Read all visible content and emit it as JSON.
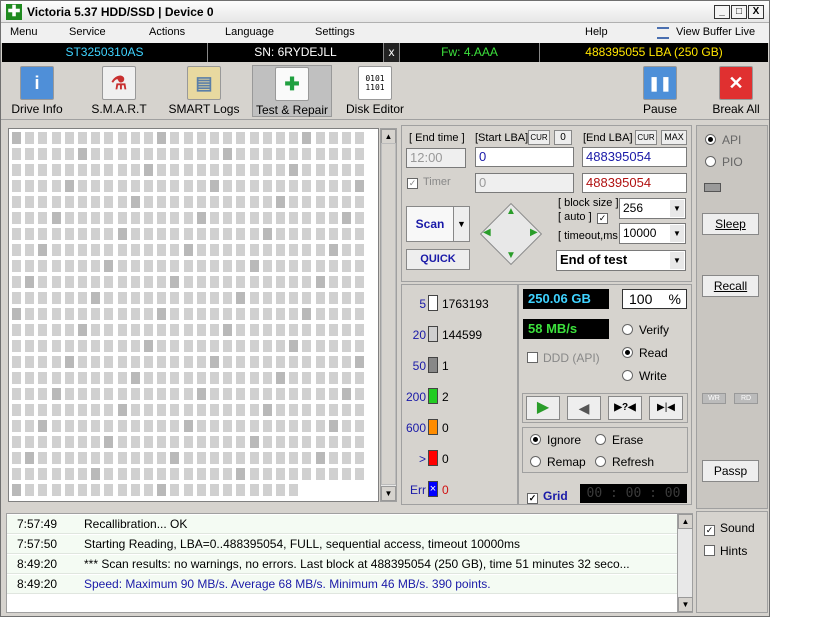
{
  "window": {
    "title": "Victoria 5.37 HDD/SSD | Device 0",
    "minimize": "_",
    "maximize": "□",
    "close": "X"
  },
  "menu": {
    "items": [
      "Menu",
      "Service",
      "Actions",
      "Language",
      "Settings",
      "Help"
    ],
    "view_buffer": "View Buffer Live"
  },
  "device": {
    "model": "ST3250310AS",
    "serial": "SN: 6RYDEJLL",
    "close": "x",
    "firmware": "Fw: 4.AAA",
    "capacity": "488395055 LBA (250 GB)"
  },
  "toolbar": {
    "drive_info": "Drive Info",
    "smart": "S.M.A.R.T",
    "smart_logs": "SMART Logs",
    "test_repair": "Test & Repair",
    "disk_editor": "Disk Editor",
    "pause": "Pause",
    "break_all": "Break All"
  },
  "scan": {
    "end_time_label": "[ End time ]",
    "start_lba_label": "[Start LBA]",
    "cur": "CUR",
    "zero": "0",
    "end_lba_label": "[End LBA]",
    "cur2": "CUR",
    "max": "MAX",
    "end_time_value": "12:00",
    "start_lba": "0",
    "end_lba": "488395054",
    "timer_label": "Timer",
    "timer_value": "0",
    "end_lba_red": "488395054",
    "block_size_label": "[ block size ]",
    "auto_label": "[ auto ]",
    "block_size": "256",
    "timeout_label": "[ timeout,ms ]",
    "timeout": "10000",
    "scan_button": "Scan",
    "quick_button": "QUICK",
    "end_mode": "End of test"
  },
  "legend": [
    {
      "label": "5",
      "count": "1763193",
      "color": "#ffffff"
    },
    {
      "label": "20",
      "count": "144599",
      "color": "#cfcfcf"
    },
    {
      "label": "50",
      "count": "1",
      "color": "#888888"
    },
    {
      "label": "200",
      "count": "2",
      "color": "#22cc22"
    },
    {
      "label": "600",
      "count": "0",
      "color": "#ff8c00"
    },
    {
      "label": ">",
      "count": "0",
      "color": "#ff0000"
    },
    {
      "label": "Err",
      "count": "0",
      "color": "#0000ff"
    }
  ],
  "stats": {
    "size": "250.06 GB",
    "percent": "100",
    "percent_sign": "%",
    "speed": "58 MB/s",
    "ddd": "DDD (API)",
    "verify": "Verify",
    "read": "Read",
    "write": "Write",
    "ignore": "Ignore",
    "erase": "Erase",
    "remap": "Remap",
    "refresh": "Refresh",
    "grid": "Grid",
    "timer_display": "00 : 00 : 00"
  },
  "right": {
    "api": "API",
    "pio": "PIO",
    "sleep": "Sleep",
    "recall": "Recall",
    "wr": "WR",
    "rd": "RD",
    "passp": "Passp",
    "sound": "Sound",
    "hints": "Hints"
  },
  "log": [
    {
      "time": "7:57:49",
      "msg": "Recallibration... OK",
      "color": "#000000"
    },
    {
      "time": "7:57:50",
      "msg": "Starting Reading, LBA=0..488395054, FULL, sequential access, timeout 10000ms",
      "color": "#000000"
    },
    {
      "time": "8:49:20",
      "msg": "*** Scan results: no warnings, no errors. Last block at 488395054 (250 GB), time 51 minutes 32 seco...",
      "color": "#000000"
    },
    {
      "time": "8:49:20",
      "msg": "Speed: Maximum 90 MB/s. Average 68 MB/s. Minimum 46 MB/s. 390 points.",
      "color": "#1a1aa8"
    }
  ]
}
